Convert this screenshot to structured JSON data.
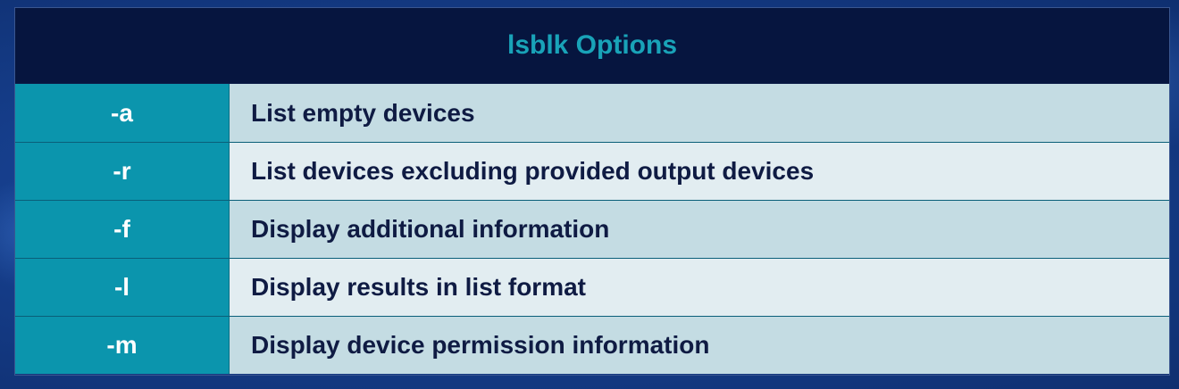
{
  "table": {
    "title": "lsblk Options",
    "rows": [
      {
        "option": "-a",
        "description": "List empty devices"
      },
      {
        "option": "-r",
        "description": "List devices excluding provided output devices"
      },
      {
        "option": "-f",
        "description": "Display additional information"
      },
      {
        "option": "-l",
        "description": "Display results in list format"
      },
      {
        "option": "-m",
        "description": "Display device permission information"
      }
    ]
  },
  "colors": {
    "header_bg": "#06153f",
    "header_text": "#19a3b8",
    "option_bg": "#0b95ad",
    "row_odd_bg": "#c4dce3",
    "row_even_bg": "#e2edf1",
    "slide_bg": "#163f8d"
  }
}
